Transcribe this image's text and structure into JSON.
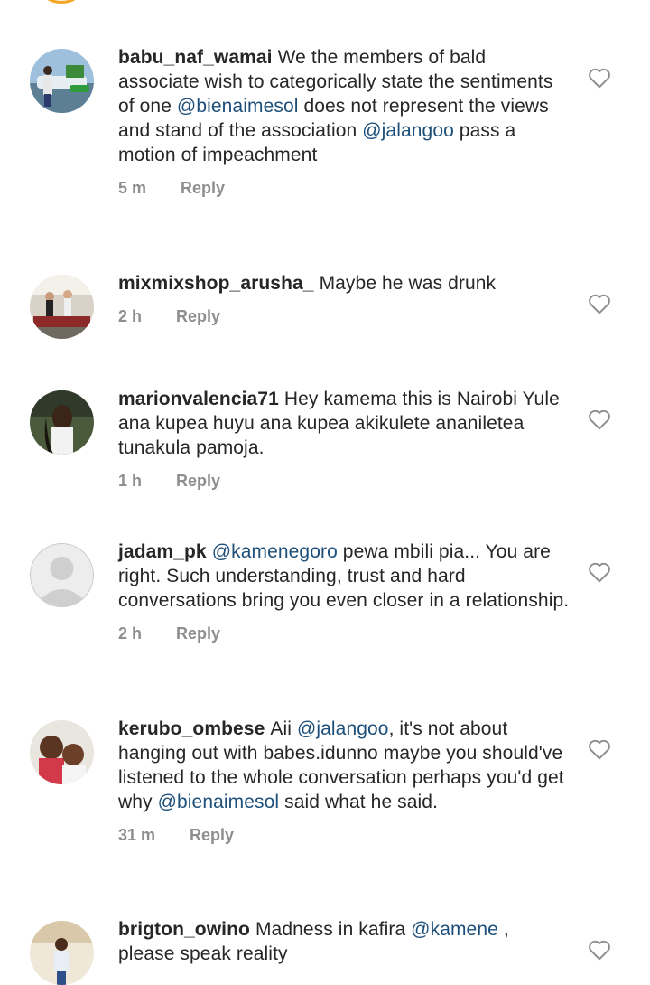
{
  "comments": [
    {
      "username": "babu_naf_wamai",
      "segments": [
        {
          "text": "We the members of bald associate wish to categorically state the sentiments of one "
        },
        {
          "text": "@bienaimesol",
          "mention": true
        },
        {
          "text": "  does not represent the views and stand of the association "
        },
        {
          "text": "@jalangoo",
          "mention": true
        },
        {
          "text": "  pass a motion of impeachment"
        }
      ],
      "time": "5 m",
      "reply_label": "Reply",
      "avatar_icon": "profile-photo-boat"
    },
    {
      "username": "mixmixshop_arusha_",
      "segments": [
        {
          "text": "Maybe he was drunk"
        }
      ],
      "time": "2 h",
      "reply_label": "Reply",
      "avatar_icon": "profile-photo-shop"
    },
    {
      "username": "marionvalencia71",
      "segments": [
        {
          "text": "Hey kamema this is Nairobi Yule ana kupea  huyu ana kupea akikulete ananiletea tunakula pamoja."
        }
      ],
      "time": "1 h",
      "reply_label": "Reply",
      "avatar_icon": "profile-photo-woman"
    },
    {
      "username": "jadam_pk",
      "segments": [
        {
          "text": "@kamenegoro",
          "mention": true
        },
        {
          "text": " pewa mbili pia... You are right. Such understanding, trust and hard conversations bring you even closer in a relationship."
        }
      ],
      "time": "2 h",
      "reply_label": "Reply",
      "avatar_icon": "default-avatar"
    },
    {
      "username": "kerubo_ombese",
      "segments": [
        {
          "text": "Aii "
        },
        {
          "text": "@jalangoo",
          "mention": true
        },
        {
          "text": ", it's not about hanging out with babes.idunno maybe you should've listened to the whole conversation perhaps you'd get why "
        },
        {
          "text": "@bienaimesol",
          "mention": true
        },
        {
          "text": " said what he said."
        }
      ],
      "time": "31 m",
      "reply_label": "Reply",
      "avatar_icon": "profile-photo-two-people"
    },
    {
      "username": "brigton_owino",
      "segments": [
        {
          "text": "Madness in kafira "
        },
        {
          "text": "@kamene",
          "mention": true
        },
        {
          "text": " , please speak reality"
        }
      ],
      "time": "",
      "reply_label": "",
      "avatar_icon": "profile-photo-man"
    }
  ],
  "colors": {
    "text": "#262626",
    "mention": "#1d4f7a",
    "meta": "#8e8e8e",
    "story_ring": "#f5a623"
  },
  "icons": {
    "like": "heart-outline-icon"
  }
}
